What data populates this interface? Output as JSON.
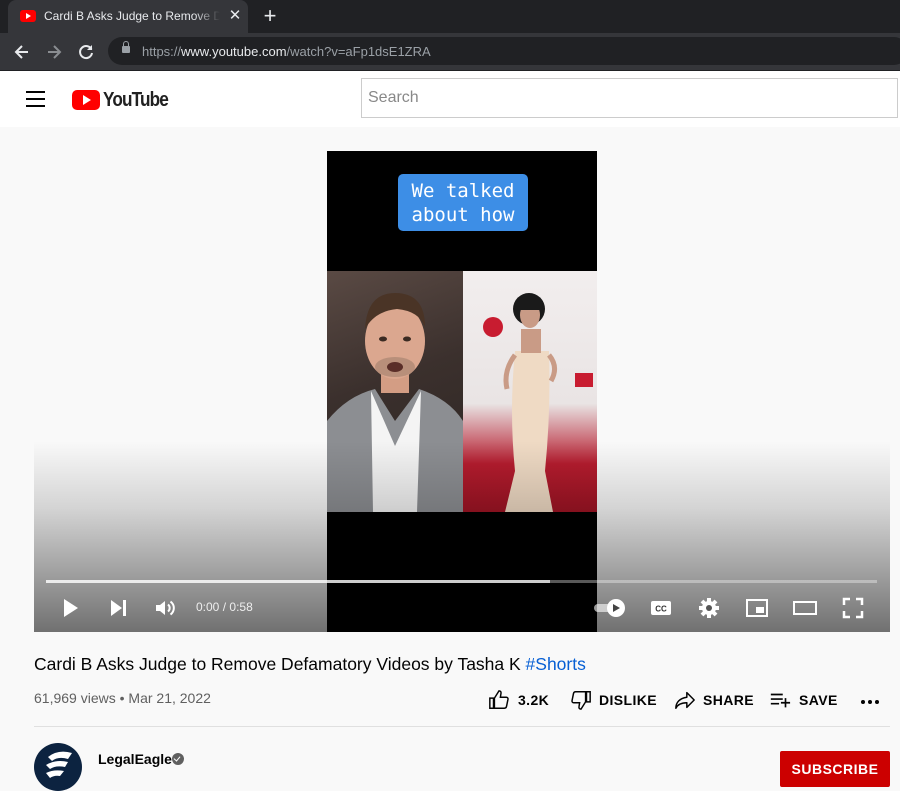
{
  "browser": {
    "tab_title": "Cardi B Asks Judge to Remove Defamatory Videos by Tasha K #Shorts - YouTube",
    "url_scheme": "https://",
    "url_host": "www.youtube.com",
    "url_path": "/watch?v=aFp1dsE1ZRA"
  },
  "masthead": {
    "logo_text": "YouTube",
    "search_placeholder": "Search"
  },
  "player": {
    "caption_line1": "We talked",
    "caption_line2": "about how",
    "time_current": "0:00",
    "time_separator": "/",
    "time_duration": "0:58",
    "buffered_fraction": 0.607,
    "autoplay": true
  },
  "video": {
    "title": "Cardi B Asks Judge to Remove Defamatory Videos by Tasha K ",
    "hashtag": "#Shorts",
    "views": "61,969 views",
    "separator": "•",
    "date": "Mar 21, 2022"
  },
  "actions": {
    "like_count": "3.2K",
    "dislike_label": "DISLIKE",
    "share_label": "SHARE",
    "save_label": "SAVE"
  },
  "channel": {
    "name": "LegalEagle",
    "subscribe_label": "SUBSCRIBE"
  },
  "colors": {
    "brand_red": "#ff0000",
    "subscribe_red": "#cc0000",
    "link_blue": "#065fd4",
    "caption_blue": "#3d8ee6"
  }
}
